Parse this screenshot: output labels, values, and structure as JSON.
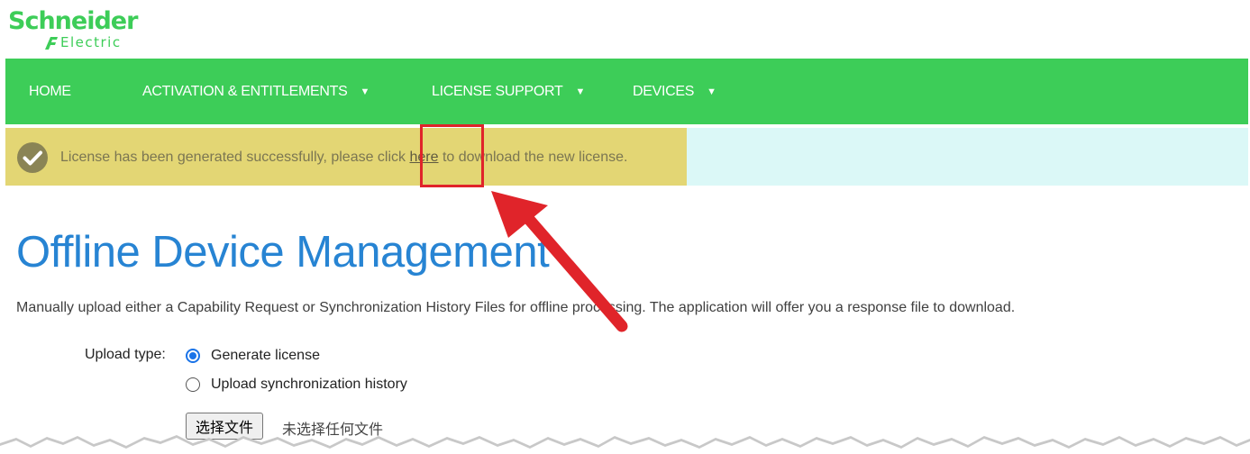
{
  "brand": {
    "logo_line1": "Schneider",
    "logo_line2": "Electric",
    "color": "#3dcd58"
  },
  "nav": {
    "items": [
      {
        "label": "HOME",
        "has_dropdown": false,
        "caret": ""
      },
      {
        "label": "ACTIVATION & ENTITLEMENTS",
        "has_dropdown": true,
        "caret": "▼"
      },
      {
        "label": "LICENSE SUPPORT",
        "has_dropdown": true,
        "caret": "▼"
      },
      {
        "label": "DEVICES",
        "has_dropdown": true,
        "caret": "▼"
      }
    ]
  },
  "alert": {
    "icon": "check-circle-icon",
    "text_before": "License has been generated successfully, please click ",
    "link_text": "here",
    "text_after": " to download the new license."
  },
  "page": {
    "title": "Offline Device Management",
    "description": "Manually upload either a Capability Request or Synchronization History Files for offline processing. The application will offer you a response file to download."
  },
  "form": {
    "upload_type_label": "Upload type:",
    "options": [
      {
        "label": "Generate license",
        "checked": true
      },
      {
        "label": "Upload synchronization history",
        "checked": false
      }
    ],
    "file_button_label": "选择文件",
    "file_status": "未选择任何文件"
  },
  "annotation": {
    "highlight_color": "#e3d674",
    "callout_color": "#e0242a"
  }
}
